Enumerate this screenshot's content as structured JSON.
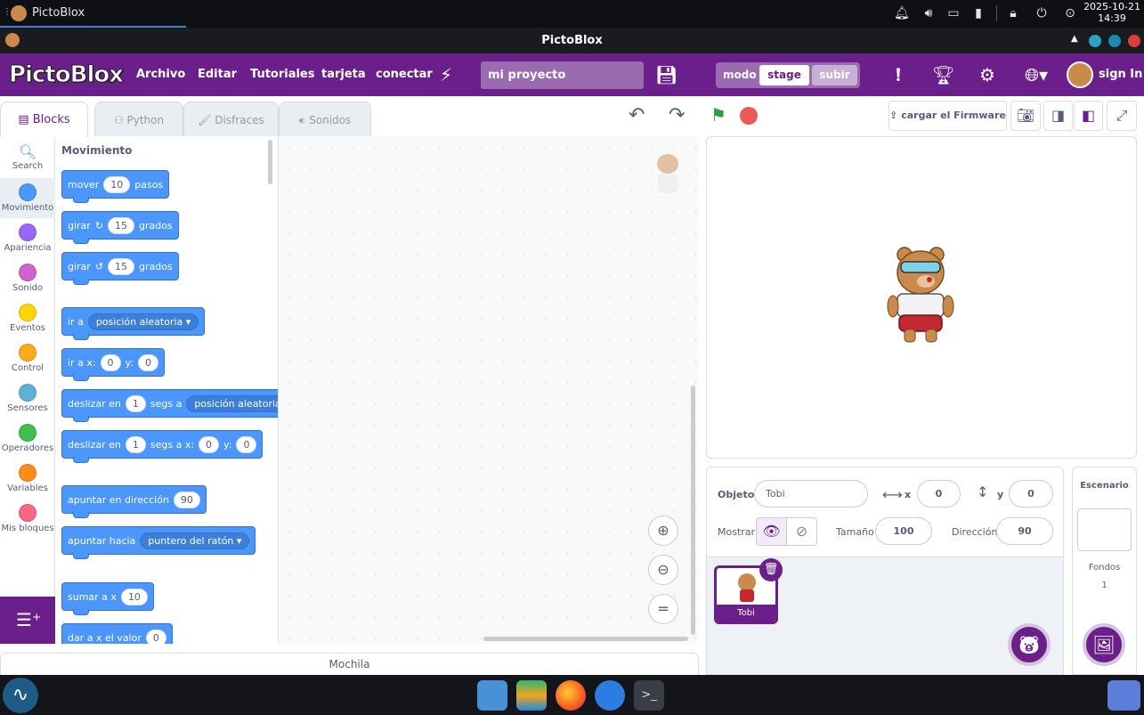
{
  "system": {
    "task_title": "PictoBlox",
    "date": "2025-10-21",
    "time": "14:39",
    "icons": [
      "bell-icon",
      "volume-icon",
      "display-icon",
      "battery-icon",
      "lock-icon",
      "power-icon",
      "play-icon"
    ]
  },
  "window": {
    "title": "PictoBlox",
    "dot_colors": [
      "#2ba3c4",
      "#1a8ab0",
      "#e03b3b"
    ]
  },
  "menubar": {
    "logo": "PictoBlox",
    "items": [
      "Archivo",
      "Editar",
      "Tutoriales",
      "tarjeta",
      "conectar"
    ],
    "project_name": "mi proyecto",
    "mode_label": "modo",
    "mode_stage": "stage",
    "mode_upload": "subir",
    "sign_in": "sign In",
    "accent": "#6b1f8a"
  },
  "tabs": [
    "Blocks",
    "Python",
    "Disfraces",
    "Sonidos"
  ],
  "categories": [
    {
      "name": "Search",
      "color": ""
    },
    {
      "name": "Movimiento",
      "color": "#4c97ff"
    },
    {
      "name": "Apariencia",
      "color": "#9966ff"
    },
    {
      "name": "Sonido",
      "color": "#cf63cf"
    },
    {
      "name": "Eventos",
      "color": "#ffd500"
    },
    {
      "name": "Control",
      "color": "#ffab19"
    },
    {
      "name": "Sensores",
      "color": "#5cb1d6"
    },
    {
      "name": "Operadores",
      "color": "#40bf4a"
    },
    {
      "name": "Variables",
      "color": "#ff8c1a"
    },
    {
      "name": "Mis bloques",
      "color": "#ff6680"
    }
  ],
  "palette": {
    "title": "Movimiento",
    "blocks": {
      "move": {
        "a": "mover",
        "v": "10",
        "b": "pasos"
      },
      "turn_right": {
        "a": "girar",
        "v": "15",
        "b": "grados"
      },
      "turn_left": {
        "a": "girar",
        "v": "15",
        "b": "grados"
      },
      "goto": {
        "a": "ir a",
        "d": "posición aleatoria"
      },
      "goto_xy": {
        "a": "ir a x:",
        "x": "0",
        "b": "y:",
        "y": "0"
      },
      "glide": {
        "a": "deslizar en",
        "v": "1",
        "b": "segs a",
        "d": "posición aleatoria"
      },
      "glide_xy": {
        "a": "deslizar en",
        "v": "1",
        "b": "segs a x:",
        "x": "0",
        "c": "y:",
        "y": "0"
      },
      "point_dir": {
        "a": "apuntar en dirección",
        "v": "90"
      },
      "point_towards": {
        "a": "apuntar hacia",
        "d": "puntero del ratón"
      },
      "change_x": {
        "a": "sumar a x",
        "v": "10"
      },
      "set_x": {
        "a": "dar a x el valor",
        "v": "0"
      }
    }
  },
  "script": {
    "backpack": "Mochila"
  },
  "toolbar": {
    "firmware": "cargar el Firmware"
  },
  "sprite": {
    "object_label": "Objeto",
    "name": "Tobi",
    "x_label": "x",
    "x": "0",
    "y_label": "y",
    "y": "0",
    "show_label": "Mostrar",
    "size_label": "Tamaño",
    "size": "100",
    "direction_label": "Dirección",
    "direction": "90",
    "thumb_label": "Tobi"
  },
  "stage_panel": {
    "title": "Escenario",
    "backdrops_label": "Fondos",
    "backdrops_count": "1"
  }
}
